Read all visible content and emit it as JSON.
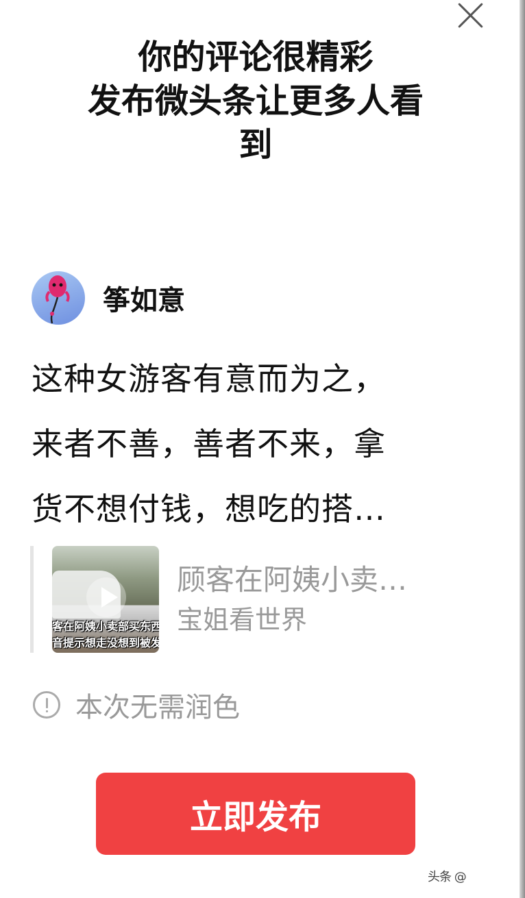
{
  "dialog": {
    "title_lines": [
      "你的评论很精彩",
      "发布微头条让更多人看",
      "到"
    ]
  },
  "author": {
    "name": "筝如意"
  },
  "comment": {
    "lines": [
      "这种女游客有意而为之，",
      "来者不善，善者不来，拿",
      "货不想付钱，想吃的搭…"
    ]
  },
  "linked_video": {
    "thumbnail_caption_lines": [
      "客在阿姨小卖部买东西",
      "音提示想走没想到被发"
    ],
    "title": "顾客在阿姨小卖…",
    "author": "宝姐看世界"
  },
  "note": {
    "text": "本次无需润色"
  },
  "publish_button": {
    "label": "立即发布"
  },
  "watermark": {
    "text": "头条 @"
  },
  "colors": {
    "accent": "#f04142",
    "muted_text": "#999999"
  }
}
